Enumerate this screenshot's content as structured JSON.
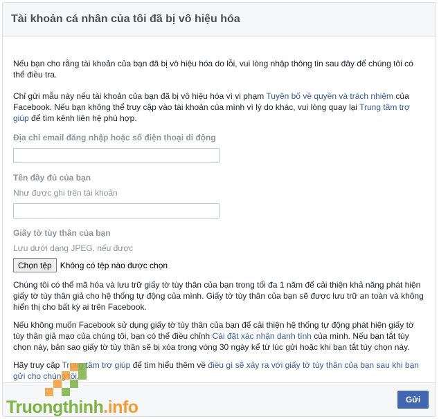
{
  "header": {
    "title": "Tài khoản cá nhân của tôi đã bị vô hiệu hóa"
  },
  "intro": {
    "text": "Nếu bạn cho rằng tài khoản của bạn đã bị vô hiệu hóa do lỗi, vui lòng nhập thông tin sau đây để chúng tôi có thể điều tra."
  },
  "notice": {
    "part1": "Chỉ gửi mẫu này nếu tài khoản của bạn đã bị vô hiệu hóa vì vi phạm ",
    "link1": "Tuyên bố về quyền và trách nhiệm",
    "part2": " của Facebook. Nếu bạn không thể truy cập vào tài khoản của mình vì lý do khác, vui lòng quay lại ",
    "link2": "Trung tâm trợ giúp",
    "part3": " để tìm kênh liên hệ phù hợp."
  },
  "fields": {
    "email": {
      "label": "Địa chỉ email đăng nhập hoặc số điện thoại di động",
      "value": ""
    },
    "fullname": {
      "label": "Tên đầy đủ của bạn",
      "hint": "Như được ghi trên tài khoản",
      "value": ""
    },
    "id": {
      "label": "Giấy tờ tùy thân của bạn",
      "hint": "Lưu dưới dạng JPEG, nếu được",
      "button": "Chọn tệp",
      "status": "Không có tệp nào được chọn"
    }
  },
  "info1": "Chúng tôi có thể mã hóa và lưu trữ giấy tờ tùy thân của bạn trong tối đa 1 năm để cải thiện khả năng phát hiện giấy tờ tùy thân giả cho hệ thống tự động của mình. Giấy tờ tùy thân của bạn sẽ được lưu trữ an toàn và không hiển thị cho bất kỳ ai trên Facebook.",
  "info2": {
    "part1": "Nếu không muốn Facebook sử dụng giấy tờ tùy thân của bạn để cải thiện hệ thống tự động phát hiện giấy tờ tùy thân giả mạo của chúng tôi, bạn có thể điều chỉnh ",
    "link": "Cài đặt xác nhận danh tính",
    "part2": " của mình. Nếu bạn tắt tùy chọn này, bản sao giấy tờ tùy thân sẽ bị xóa trong vòng 30 ngày kể từ lúc gửi hoặc khi bạn tắt tùy chọn này."
  },
  "info3": {
    "part1": "Hãy truy cập ",
    "link1": "Trung tâm trợ giúp",
    "part2": " để tìm hiểu thêm về ",
    "link2": "điều gì sẽ xảy ra với giấy tờ tùy thân của bạn sau khi bạn gửi cho chúng tôi",
    "part3": "."
  },
  "footer": {
    "send_label": "Gửi"
  },
  "watermark": {
    "part1": "Truongthinh",
    "part2": ".info"
  },
  "colors": {
    "accent": "#4267b2",
    "link": "#365899",
    "watermark_green": "#7cb342",
    "watermark_orange": "#f39c32"
  }
}
